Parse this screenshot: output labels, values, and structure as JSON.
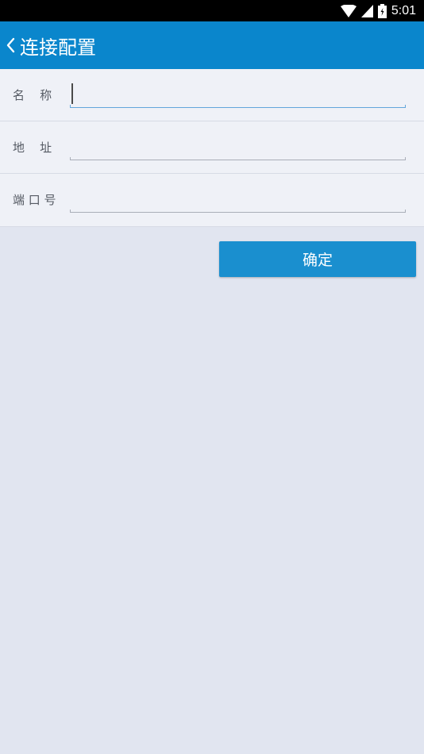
{
  "status_bar": {
    "time": "5:01",
    "icons": [
      "wifi-icon",
      "cell-signal-icon",
      "battery-icon"
    ]
  },
  "app_bar": {
    "back_icon": "chevron-left-icon",
    "title": "连接配置",
    "color": "#0a86cc"
  },
  "form": {
    "fields": [
      {
        "label": "名    称",
        "value": "",
        "placeholder": "",
        "focused": true
      },
      {
        "label": "地    址",
        "value": "",
        "placeholder": "",
        "focused": false
      },
      {
        "label": "端 口 号",
        "value": "",
        "placeholder": "",
        "focused": false
      }
    ]
  },
  "actions": {
    "confirm_label": "确定",
    "confirm_color": "#1a8fcf"
  }
}
